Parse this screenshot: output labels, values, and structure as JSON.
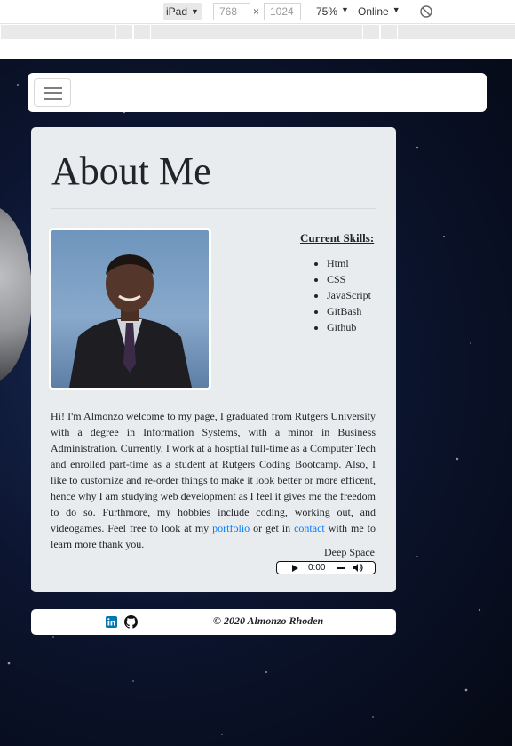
{
  "devtools": {
    "device": "iPad",
    "width": "768",
    "height": "1024",
    "dim_separator": "×",
    "zoom": "75%",
    "throttling": "Online"
  },
  "page": {
    "about": {
      "title": "About Me",
      "skills_heading": "Current Skills:",
      "skills": [
        "Html",
        "CSS",
        "JavaScript",
        "GitBash",
        "Github"
      ],
      "bio_1": "Hi! I'm Almonzo welcome to my page, I graduated from Rutgers University with a degree in Information Systems, with a minor in Business Administration. Currently, I work at a hosptial full-time as a Computer Tech and enrolled part-time as a student at Rutgers Coding Bootcamp. Also, I like to customize and re-order things to make it look better or more efficent, hence why I am studying web development as I feel it gives me the freedom to do so. Furthmore, my hobbies include coding, working out, and videogames. Feel free to look at my ",
      "portfolio_link": "portfolio",
      "bio_2": " or get in ",
      "contact_link": "contact",
      "bio_3": " with me to learn more thank you.",
      "audio_title": "Deep Space",
      "audio_time": "0:00",
      "audio_progress": 0
    },
    "footer": {
      "copyright": "© 2020 Almonzo Rhoden",
      "icons": [
        "linkedin-icon",
        "github-icon"
      ]
    }
  },
  "colors": {
    "link": "#007bff",
    "card": "#e9ecef",
    "linkedin": "#0077b5"
  }
}
